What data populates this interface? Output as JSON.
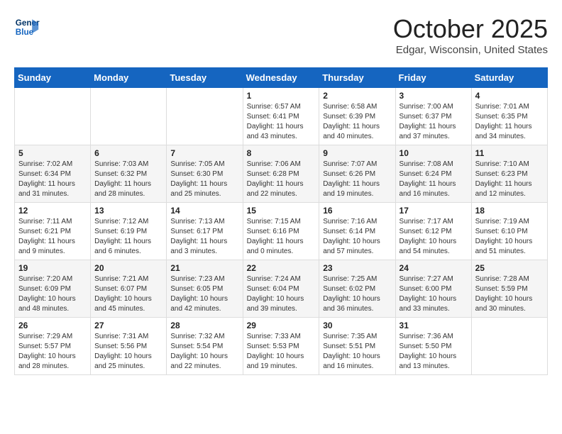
{
  "header": {
    "logo_line1": "General",
    "logo_line2": "Blue",
    "month": "October 2025",
    "location": "Edgar, Wisconsin, United States"
  },
  "days_of_week": [
    "Sunday",
    "Monday",
    "Tuesday",
    "Wednesday",
    "Thursday",
    "Friday",
    "Saturday"
  ],
  "weeks": [
    [
      {
        "day": "",
        "info": ""
      },
      {
        "day": "",
        "info": ""
      },
      {
        "day": "",
        "info": ""
      },
      {
        "day": "1",
        "info": "Sunrise: 6:57 AM\nSunset: 6:41 PM\nDaylight: 11 hours\nand 43 minutes."
      },
      {
        "day": "2",
        "info": "Sunrise: 6:58 AM\nSunset: 6:39 PM\nDaylight: 11 hours\nand 40 minutes."
      },
      {
        "day": "3",
        "info": "Sunrise: 7:00 AM\nSunset: 6:37 PM\nDaylight: 11 hours\nand 37 minutes."
      },
      {
        "day": "4",
        "info": "Sunrise: 7:01 AM\nSunset: 6:35 PM\nDaylight: 11 hours\nand 34 minutes."
      }
    ],
    [
      {
        "day": "5",
        "info": "Sunrise: 7:02 AM\nSunset: 6:34 PM\nDaylight: 11 hours\nand 31 minutes."
      },
      {
        "day": "6",
        "info": "Sunrise: 7:03 AM\nSunset: 6:32 PM\nDaylight: 11 hours\nand 28 minutes."
      },
      {
        "day": "7",
        "info": "Sunrise: 7:05 AM\nSunset: 6:30 PM\nDaylight: 11 hours\nand 25 minutes."
      },
      {
        "day": "8",
        "info": "Sunrise: 7:06 AM\nSunset: 6:28 PM\nDaylight: 11 hours\nand 22 minutes."
      },
      {
        "day": "9",
        "info": "Sunrise: 7:07 AM\nSunset: 6:26 PM\nDaylight: 11 hours\nand 19 minutes."
      },
      {
        "day": "10",
        "info": "Sunrise: 7:08 AM\nSunset: 6:24 PM\nDaylight: 11 hours\nand 16 minutes."
      },
      {
        "day": "11",
        "info": "Sunrise: 7:10 AM\nSunset: 6:23 PM\nDaylight: 11 hours\nand 12 minutes."
      }
    ],
    [
      {
        "day": "12",
        "info": "Sunrise: 7:11 AM\nSunset: 6:21 PM\nDaylight: 11 hours\nand 9 minutes."
      },
      {
        "day": "13",
        "info": "Sunrise: 7:12 AM\nSunset: 6:19 PM\nDaylight: 11 hours\nand 6 minutes."
      },
      {
        "day": "14",
        "info": "Sunrise: 7:13 AM\nSunset: 6:17 PM\nDaylight: 11 hours\nand 3 minutes."
      },
      {
        "day": "15",
        "info": "Sunrise: 7:15 AM\nSunset: 6:16 PM\nDaylight: 11 hours\nand 0 minutes."
      },
      {
        "day": "16",
        "info": "Sunrise: 7:16 AM\nSunset: 6:14 PM\nDaylight: 10 hours\nand 57 minutes."
      },
      {
        "day": "17",
        "info": "Sunrise: 7:17 AM\nSunset: 6:12 PM\nDaylight: 10 hours\nand 54 minutes."
      },
      {
        "day": "18",
        "info": "Sunrise: 7:19 AM\nSunset: 6:10 PM\nDaylight: 10 hours\nand 51 minutes."
      }
    ],
    [
      {
        "day": "19",
        "info": "Sunrise: 7:20 AM\nSunset: 6:09 PM\nDaylight: 10 hours\nand 48 minutes."
      },
      {
        "day": "20",
        "info": "Sunrise: 7:21 AM\nSunset: 6:07 PM\nDaylight: 10 hours\nand 45 minutes."
      },
      {
        "day": "21",
        "info": "Sunrise: 7:23 AM\nSunset: 6:05 PM\nDaylight: 10 hours\nand 42 minutes."
      },
      {
        "day": "22",
        "info": "Sunrise: 7:24 AM\nSunset: 6:04 PM\nDaylight: 10 hours\nand 39 minutes."
      },
      {
        "day": "23",
        "info": "Sunrise: 7:25 AM\nSunset: 6:02 PM\nDaylight: 10 hours\nand 36 minutes."
      },
      {
        "day": "24",
        "info": "Sunrise: 7:27 AM\nSunset: 6:00 PM\nDaylight: 10 hours\nand 33 minutes."
      },
      {
        "day": "25",
        "info": "Sunrise: 7:28 AM\nSunset: 5:59 PM\nDaylight: 10 hours\nand 30 minutes."
      }
    ],
    [
      {
        "day": "26",
        "info": "Sunrise: 7:29 AM\nSunset: 5:57 PM\nDaylight: 10 hours\nand 28 minutes."
      },
      {
        "day": "27",
        "info": "Sunrise: 7:31 AM\nSunset: 5:56 PM\nDaylight: 10 hours\nand 25 minutes."
      },
      {
        "day": "28",
        "info": "Sunrise: 7:32 AM\nSunset: 5:54 PM\nDaylight: 10 hours\nand 22 minutes."
      },
      {
        "day": "29",
        "info": "Sunrise: 7:33 AM\nSunset: 5:53 PM\nDaylight: 10 hours\nand 19 minutes."
      },
      {
        "day": "30",
        "info": "Sunrise: 7:35 AM\nSunset: 5:51 PM\nDaylight: 10 hours\nand 16 minutes."
      },
      {
        "day": "31",
        "info": "Sunrise: 7:36 AM\nSunset: 5:50 PM\nDaylight: 10 hours\nand 13 minutes."
      },
      {
        "day": "",
        "info": ""
      }
    ]
  ]
}
